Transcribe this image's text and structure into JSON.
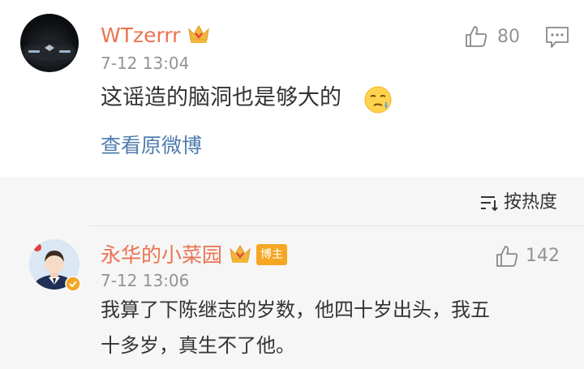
{
  "comments": [
    {
      "username": "WTzerrr",
      "timestamp": "7-12 13:04",
      "likes": "80",
      "text": "这谣造的脑洞也是够大的",
      "view_original": "查看原微博"
    }
  ],
  "sort": {
    "label": "按热度"
  },
  "replies": [
    {
      "username": "永华的小菜园",
      "badge": "博主",
      "timestamp": "7-12 13:06",
      "likes": "142",
      "text_line1": "我算了下陈继志的岁数，他四十岁出头，我五",
      "text_line2": "十多岁，真生不了他。"
    }
  ],
  "colors": {
    "username": "#eb7350",
    "link": "#507daf",
    "meta": "#939393",
    "text": "#333333",
    "section_bg": "#f6f6f6"
  },
  "icons": {
    "crown": "crown-icon",
    "like": "thumbs-up-icon",
    "comment": "comment-icon",
    "emoji": "sweat-emoji-icon",
    "sort": "sort-icon",
    "verified": "verified-badge-icon"
  }
}
